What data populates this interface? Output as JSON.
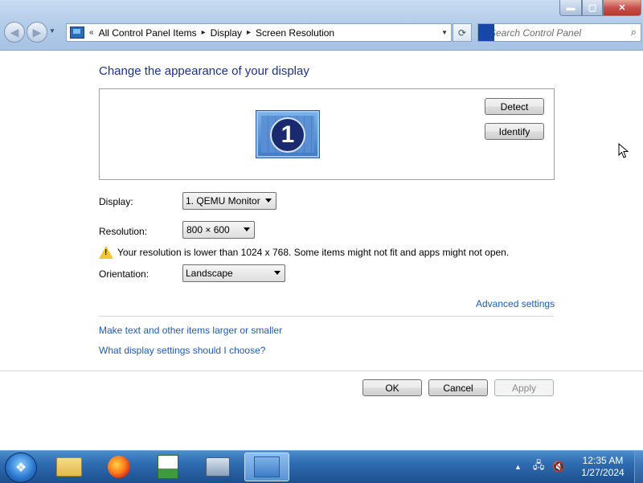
{
  "window": {
    "minimize_glyph": "▬",
    "maximize_glyph": "▢",
    "close_glyph": "✕"
  },
  "address": {
    "chevron": "«",
    "crumbs": [
      "All Control Panel Items",
      "Display",
      "Screen Resolution"
    ],
    "separator": "▸",
    "search_placeholder": "Search Control Panel"
  },
  "content": {
    "title": "Change the appearance of your display",
    "monitor_number": "1",
    "detect_label": "Detect",
    "identify_label": "Identify",
    "display_label": "Display:",
    "display_value": "1. QEMU Monitor",
    "resolution_label": "Resolution:",
    "resolution_value": "800 × 600",
    "warning_text": "Your resolution is lower than 1024 x 768. Some items might not fit and apps might not open.",
    "orientation_label": "Orientation:",
    "orientation_value": "Landscape",
    "advanced_link": "Advanced settings",
    "link_text_size": "Make text and other items larger or smaller",
    "link_help": "What display settings should I choose?",
    "ok_label": "OK",
    "cancel_label": "Cancel",
    "apply_label": "Apply"
  },
  "taskbar": {
    "apps": [
      "folder-icon",
      "firefox-icon",
      "chart-icon",
      "computer-icon",
      "display-settings-icon"
    ],
    "active_app": "display-settings-icon",
    "time": "12:35 AM",
    "date": "1/27/2024"
  },
  "colors": {
    "title_blue": "#1e3287",
    "link_blue": "#1e5bb5",
    "warning_yellow": "#f2c531",
    "taskbar_blue": "#2f6bb0"
  }
}
